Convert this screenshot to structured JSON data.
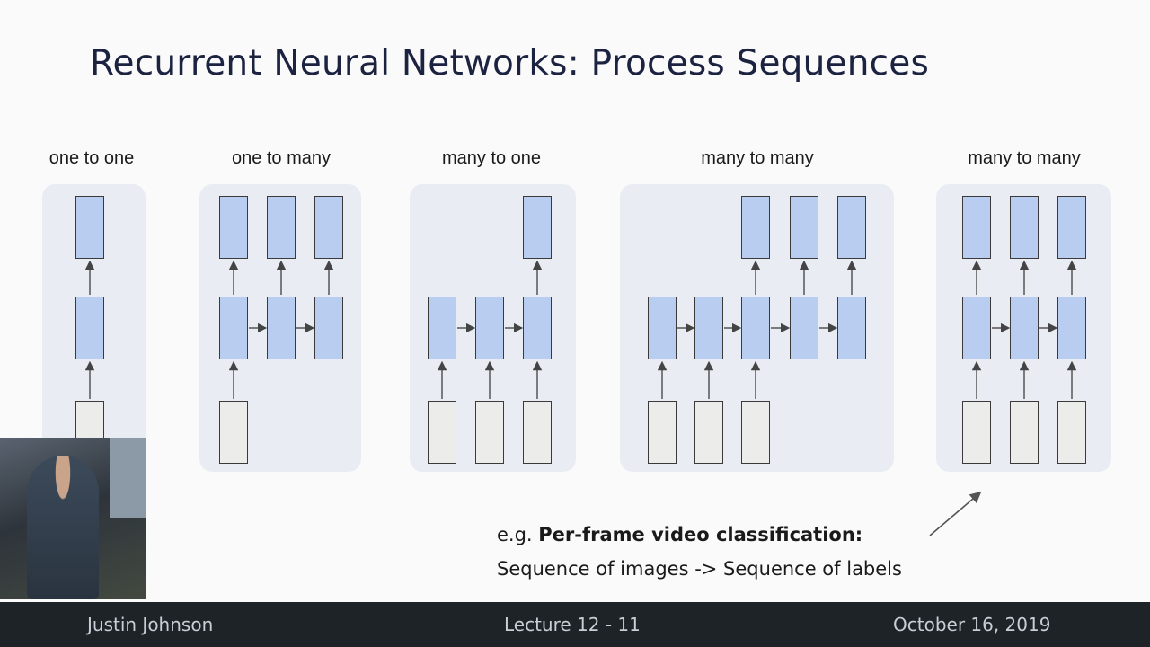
{
  "slide": {
    "title": "Recurrent Neural Networks: Process Sequences"
  },
  "diagrams": [
    {
      "label": "one to one"
    },
    {
      "label": "one to many"
    },
    {
      "label": "many to one"
    },
    {
      "label": "many to many"
    },
    {
      "label": "many to many"
    }
  ],
  "caption": {
    "prefix": "e.g. ",
    "bold": "Per-frame video classification:",
    "line2": "Sequence of images -> Sequence of labels"
  },
  "footer": {
    "author": "Justin Johnson",
    "lecture": "Lecture 12 - 11",
    "date": "October 16, 2019"
  },
  "colors": {
    "output_box": "#b9cdf0",
    "hidden_box": "#b9cdf0",
    "input_box": "#ececea",
    "panel_bg": "#e9edf3",
    "footer_bg": "#1d2327"
  }
}
